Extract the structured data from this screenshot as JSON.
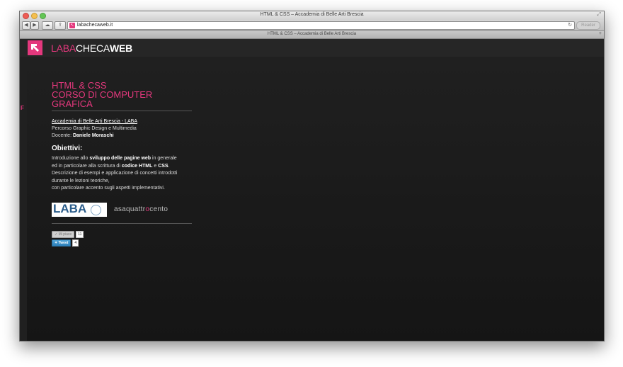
{
  "window": {
    "title": "HTML & CSS – Accademia di Belle Arti Brescia"
  },
  "toolbar": {
    "url": "labachecaweb.it",
    "reader_label": "Reader",
    "back_icon": "back-arrow-icon",
    "forward_icon": "forward-arrow-icon",
    "icloud_icon": "cloud-icon",
    "share_icon": "share-icon",
    "reload_icon": "reload-icon"
  },
  "tab": {
    "title": "HTML & CSS – Accademia di Belle Arti Brescia"
  },
  "header": {
    "logo_text_1": "LABA",
    "logo_text_2": "CHECA",
    "logo_text_3": "WEB"
  },
  "content": {
    "title_line1": "HTML & CSS",
    "title_line2": "CORSO DI COMPUTER GRAFICA",
    "school_link": "Accademia di Belle Arti Brescia - LABA",
    "course": "Percorso Graphic Design e Multimedia",
    "teacher_label": "Docente:",
    "teacher_name": "Daniele Moraschi",
    "objectives_title": "Obiettivi:",
    "desc_1a": "Introduzione allo ",
    "desc_1b": "sviluppo delle pagine web",
    "desc_1c": " in generale",
    "desc_2a": "ed in particolare alla scrittura di ",
    "desc_2b": "codice HTML",
    "desc_2c": " e ",
    "desc_2d": "CSS",
    "desc_2e": ".",
    "desc_3": "Descrizione di esempi e applicazione di concetti introdotti",
    "desc_4": "durante le lezioni teoriche,",
    "desc_5": "con particolare accento sugli aspetti implementativi.",
    "laba_logo": "LABA",
    "asa_logo_1": "asaquattr",
    "asa_logo_2": "o",
    "asa_logo_3": "cento"
  },
  "social": {
    "like_label": "Mi piace",
    "like_count": "11",
    "tweet_label": "Tweet",
    "tweet_count": "4"
  },
  "colors": {
    "accent": "#e4387d",
    "background": "#1b1b1b"
  }
}
